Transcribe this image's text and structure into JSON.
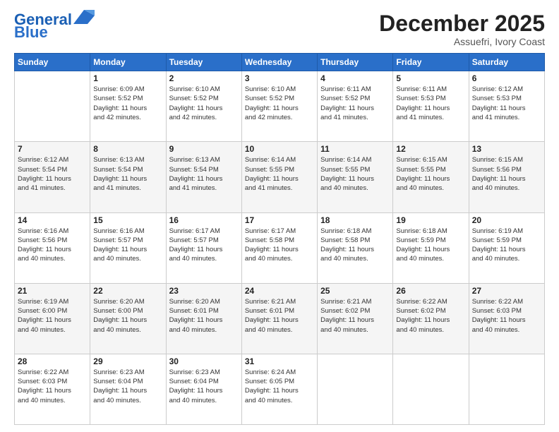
{
  "logo": {
    "line1": "General",
    "line2": "Blue"
  },
  "title": "December 2025",
  "subtitle": "Assuefri, Ivory Coast",
  "days_of_week": [
    "Sunday",
    "Monday",
    "Tuesday",
    "Wednesday",
    "Thursday",
    "Friday",
    "Saturday"
  ],
  "weeks": [
    [
      {
        "day": "",
        "info": ""
      },
      {
        "day": "1",
        "info": "Sunrise: 6:09 AM\nSunset: 5:52 PM\nDaylight: 11 hours\nand 42 minutes."
      },
      {
        "day": "2",
        "info": "Sunrise: 6:10 AM\nSunset: 5:52 PM\nDaylight: 11 hours\nand 42 minutes."
      },
      {
        "day": "3",
        "info": "Sunrise: 6:10 AM\nSunset: 5:52 PM\nDaylight: 11 hours\nand 42 minutes."
      },
      {
        "day": "4",
        "info": "Sunrise: 6:11 AM\nSunset: 5:52 PM\nDaylight: 11 hours\nand 41 minutes."
      },
      {
        "day": "5",
        "info": "Sunrise: 6:11 AM\nSunset: 5:53 PM\nDaylight: 11 hours\nand 41 minutes."
      },
      {
        "day": "6",
        "info": "Sunrise: 6:12 AM\nSunset: 5:53 PM\nDaylight: 11 hours\nand 41 minutes."
      }
    ],
    [
      {
        "day": "7",
        "info": "Sunrise: 6:12 AM\nSunset: 5:54 PM\nDaylight: 11 hours\nand 41 minutes."
      },
      {
        "day": "8",
        "info": "Sunrise: 6:13 AM\nSunset: 5:54 PM\nDaylight: 11 hours\nand 41 minutes."
      },
      {
        "day": "9",
        "info": "Sunrise: 6:13 AM\nSunset: 5:54 PM\nDaylight: 11 hours\nand 41 minutes."
      },
      {
        "day": "10",
        "info": "Sunrise: 6:14 AM\nSunset: 5:55 PM\nDaylight: 11 hours\nand 41 minutes."
      },
      {
        "day": "11",
        "info": "Sunrise: 6:14 AM\nSunset: 5:55 PM\nDaylight: 11 hours\nand 40 minutes."
      },
      {
        "day": "12",
        "info": "Sunrise: 6:15 AM\nSunset: 5:55 PM\nDaylight: 11 hours\nand 40 minutes."
      },
      {
        "day": "13",
        "info": "Sunrise: 6:15 AM\nSunset: 5:56 PM\nDaylight: 11 hours\nand 40 minutes."
      }
    ],
    [
      {
        "day": "14",
        "info": "Sunrise: 6:16 AM\nSunset: 5:56 PM\nDaylight: 11 hours\nand 40 minutes."
      },
      {
        "day": "15",
        "info": "Sunrise: 6:16 AM\nSunset: 5:57 PM\nDaylight: 11 hours\nand 40 minutes."
      },
      {
        "day": "16",
        "info": "Sunrise: 6:17 AM\nSunset: 5:57 PM\nDaylight: 11 hours\nand 40 minutes."
      },
      {
        "day": "17",
        "info": "Sunrise: 6:17 AM\nSunset: 5:58 PM\nDaylight: 11 hours\nand 40 minutes."
      },
      {
        "day": "18",
        "info": "Sunrise: 6:18 AM\nSunset: 5:58 PM\nDaylight: 11 hours\nand 40 minutes."
      },
      {
        "day": "19",
        "info": "Sunrise: 6:18 AM\nSunset: 5:59 PM\nDaylight: 11 hours\nand 40 minutes."
      },
      {
        "day": "20",
        "info": "Sunrise: 6:19 AM\nSunset: 5:59 PM\nDaylight: 11 hours\nand 40 minutes."
      }
    ],
    [
      {
        "day": "21",
        "info": "Sunrise: 6:19 AM\nSunset: 6:00 PM\nDaylight: 11 hours\nand 40 minutes."
      },
      {
        "day": "22",
        "info": "Sunrise: 6:20 AM\nSunset: 6:00 PM\nDaylight: 11 hours\nand 40 minutes."
      },
      {
        "day": "23",
        "info": "Sunrise: 6:20 AM\nSunset: 6:01 PM\nDaylight: 11 hours\nand 40 minutes."
      },
      {
        "day": "24",
        "info": "Sunrise: 6:21 AM\nSunset: 6:01 PM\nDaylight: 11 hours\nand 40 minutes."
      },
      {
        "day": "25",
        "info": "Sunrise: 6:21 AM\nSunset: 6:02 PM\nDaylight: 11 hours\nand 40 minutes."
      },
      {
        "day": "26",
        "info": "Sunrise: 6:22 AM\nSunset: 6:02 PM\nDaylight: 11 hours\nand 40 minutes."
      },
      {
        "day": "27",
        "info": "Sunrise: 6:22 AM\nSunset: 6:03 PM\nDaylight: 11 hours\nand 40 minutes."
      }
    ],
    [
      {
        "day": "28",
        "info": "Sunrise: 6:22 AM\nSunset: 6:03 PM\nDaylight: 11 hours\nand 40 minutes."
      },
      {
        "day": "29",
        "info": "Sunrise: 6:23 AM\nSunset: 6:04 PM\nDaylight: 11 hours\nand 40 minutes."
      },
      {
        "day": "30",
        "info": "Sunrise: 6:23 AM\nSunset: 6:04 PM\nDaylight: 11 hours\nand 40 minutes."
      },
      {
        "day": "31",
        "info": "Sunrise: 6:24 AM\nSunset: 6:05 PM\nDaylight: 11 hours\nand 40 minutes."
      },
      {
        "day": "",
        "info": ""
      },
      {
        "day": "",
        "info": ""
      },
      {
        "day": "",
        "info": ""
      }
    ]
  ]
}
